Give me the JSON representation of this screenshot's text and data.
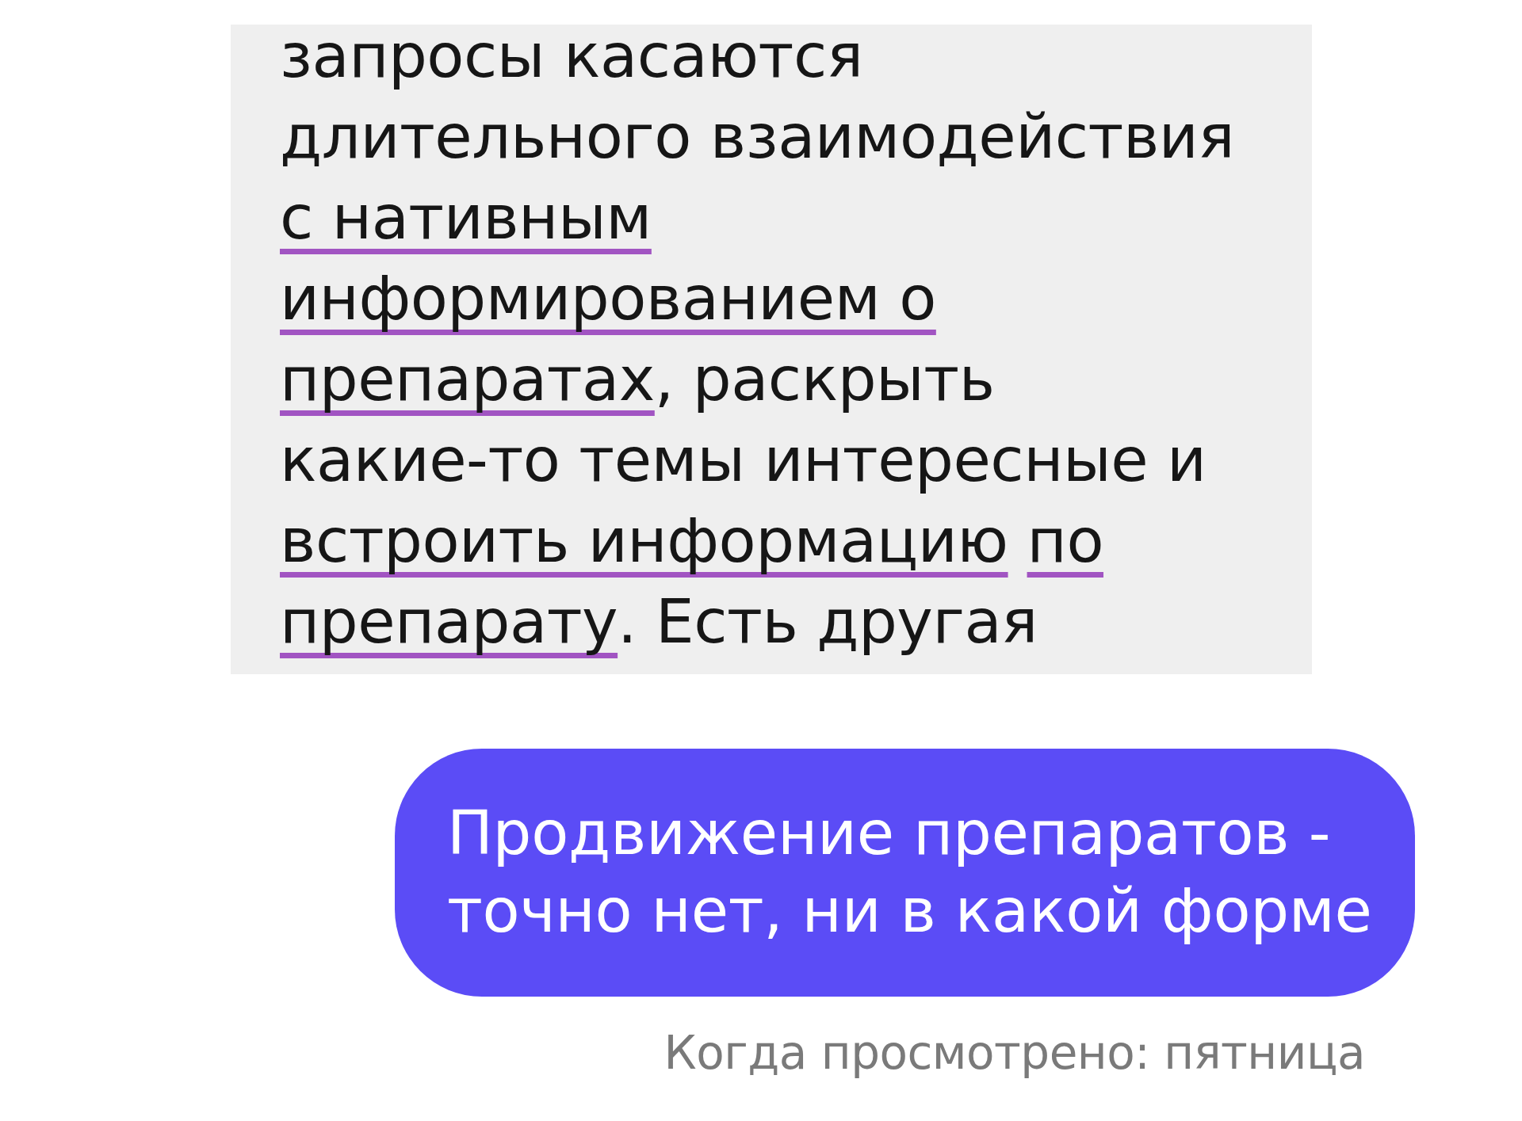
{
  "received_message": {
    "lines": [
      {
        "segments": [
          {
            "text": "запросы касаются",
            "underlined": false
          }
        ]
      },
      {
        "segments": [
          {
            "text": "длительного взаимодействия",
            "underlined": false
          }
        ]
      },
      {
        "segments": [
          {
            "text": "с нативным",
            "underlined": true
          }
        ]
      },
      {
        "segments": [
          {
            "text": "информированием о",
            "underlined": true
          }
        ]
      },
      {
        "segments": [
          {
            "text": "препаратах",
            "underlined": true
          },
          {
            "text": ", раскрыть",
            "underlined": false
          }
        ]
      },
      {
        "segments": [
          {
            "text": "какие-то темы интересные и",
            "underlined": false
          }
        ]
      },
      {
        "segments": [
          {
            "text": "встроить информацию",
            "underlined": true
          },
          {
            "text": " по",
            "underlined": true
          }
        ]
      },
      {
        "segments": [
          {
            "text": "препарату",
            "underlined": true
          },
          {
            "text": ". Есть другая",
            "underlined": false
          }
        ]
      }
    ]
  },
  "sent_message": {
    "lines": [
      "Продвижение препаратов -",
      "точно нет, ни в какой форме"
    ]
  },
  "seen_status": "Когда просмотрено: пятница"
}
